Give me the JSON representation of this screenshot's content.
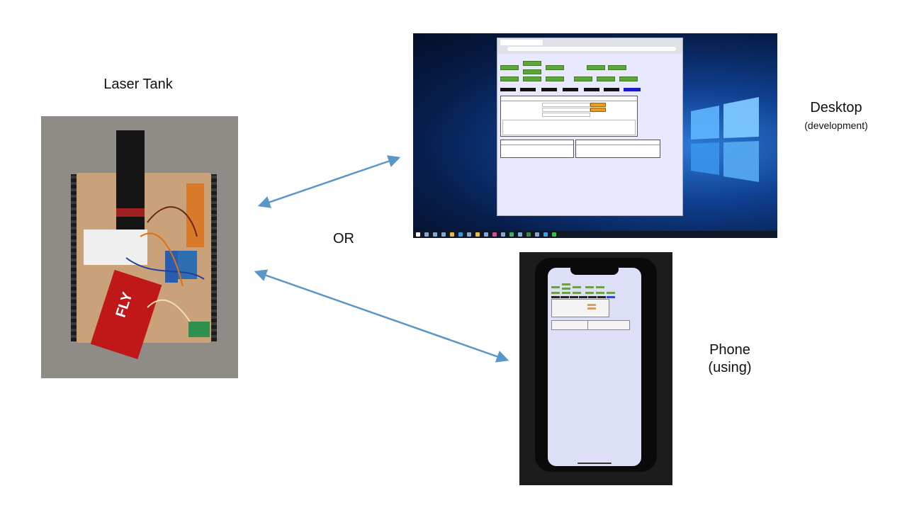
{
  "labels": {
    "tank": "Laser Tank",
    "or": "OR",
    "desktop": "Desktop",
    "desktop_sub": "(development)",
    "phone_line1": "Phone",
    "phone_line2": "(using)"
  },
  "arrow_color": "#5b96c8",
  "tank_photo": {
    "battery_text": "FLY"
  }
}
